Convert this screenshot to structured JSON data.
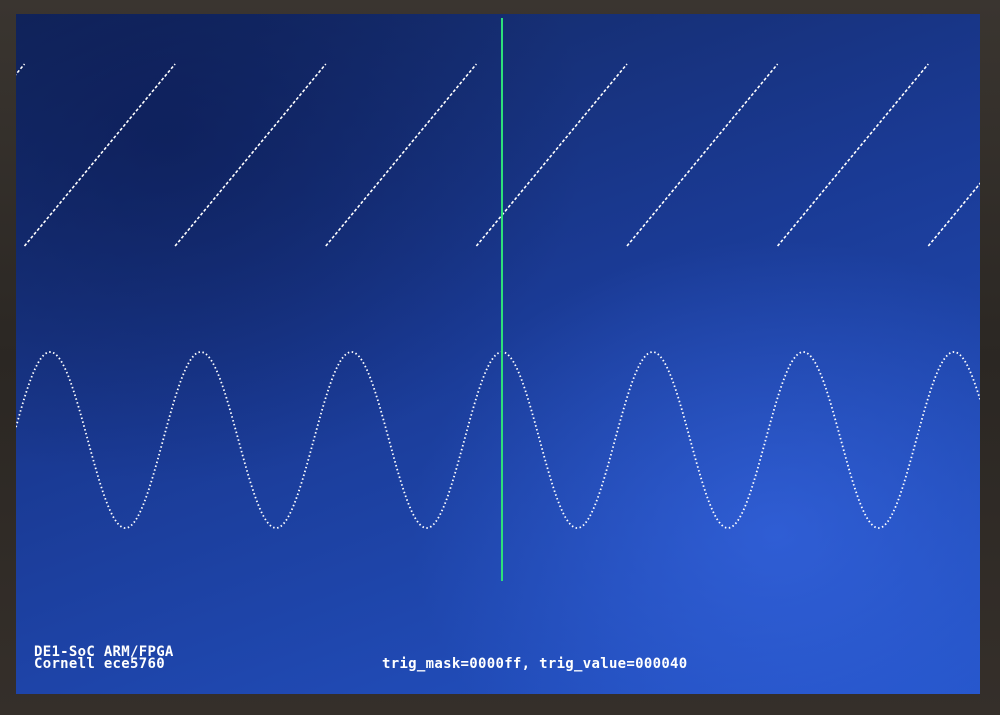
{
  "display": {
    "bottom_left_line1": "DE1-SoC ARM/FPGA",
    "bottom_left_line2": "Cornell ece5760",
    "trigger_status": "trig_mask=0000ff, trig_value=000040"
  },
  "colors": {
    "trace_color": "#ffffff",
    "cursor_color": "#2ee07a",
    "text_color": "#ffffff"
  },
  "chart_data": {
    "type": "line",
    "series": [
      {
        "waveform": "sawtooth",
        "cycles_visible": 6.4
      },
      {
        "waveform": "sine",
        "cycles_visible": 6.4
      }
    ],
    "trigger_cursor": "vertical-line",
    "grid": false
  }
}
